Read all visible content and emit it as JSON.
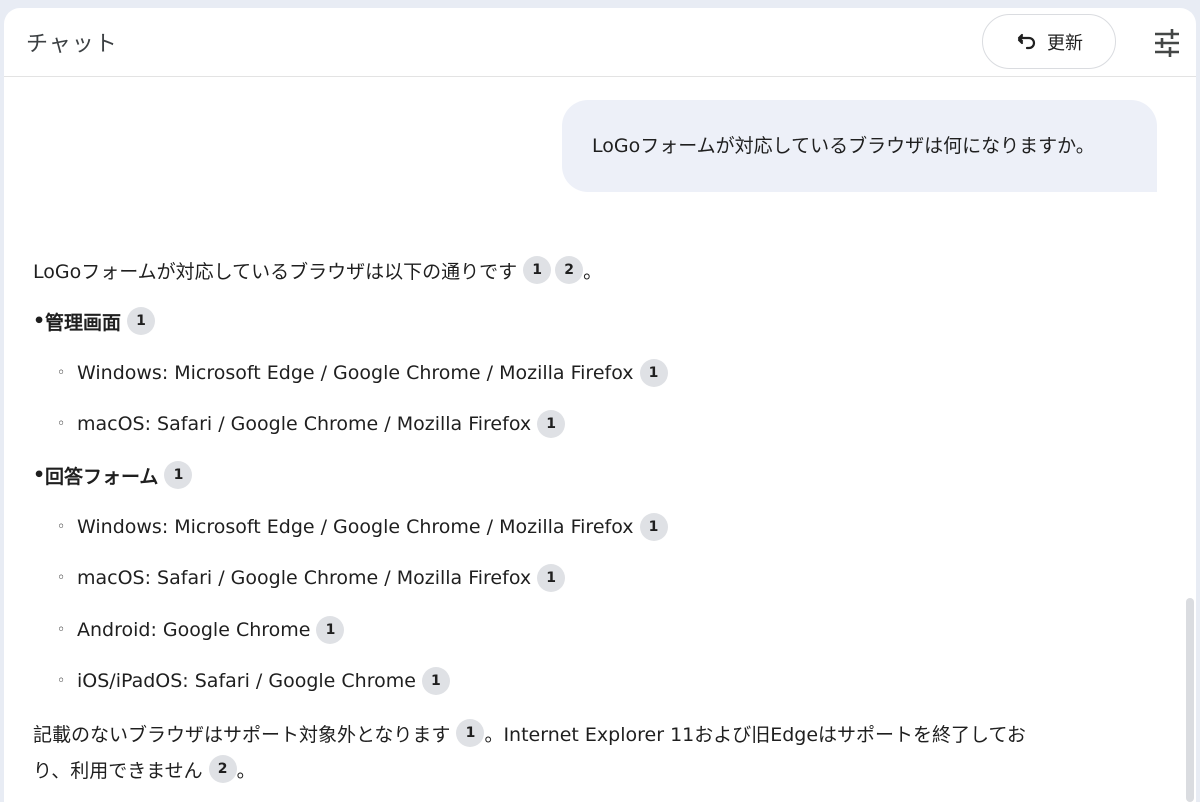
{
  "header": {
    "title": "チャット",
    "refresh_label": "更新",
    "refresh_icon": "refresh-icon",
    "tune_icon": "tune-icon"
  },
  "user_message": "LoGoフォームが対応しているブラウザは何になりますか。",
  "answer": {
    "intro": "LoGoフォームが対応しているブラウザは以下の通りです",
    "intro_cites": [
      "1",
      "2"
    ],
    "intro_end": "。",
    "sections": [
      {
        "title": "管理画面",
        "cite": "1",
        "items": [
          {
            "text": "Windows: Microsoft Edge / Google Chrome / Mozilla Firefox",
            "cite": "1"
          },
          {
            "text": "macOS: Safari / Google Chrome / Mozilla Firefox",
            "cite": "1"
          }
        ]
      },
      {
        "title": "回答フォーム",
        "cite": "1",
        "items": [
          {
            "text": "Windows: Microsoft Edge / Google Chrome / Mozilla Firefox",
            "cite": "1"
          },
          {
            "text": "macOS: Safari / Google Chrome / Mozilla Firefox",
            "cite": "1"
          },
          {
            "text": "Android: Google Chrome",
            "cite": "1"
          },
          {
            "text": "iOS/iPadOS: Safari / Google Chrome",
            "cite": "1"
          }
        ]
      }
    ],
    "footer_part1": "記載のないブラウザはサポート対象外となります",
    "footer_cite1": "1",
    "footer_part2": "。Internet Explorer 11および旧Edgeはサポートを終了してお",
    "footer_part3": "り、利用できません",
    "footer_cite2": "2",
    "footer_end": "。"
  },
  "bullet_char": "•",
  "sub_bullet_char": "◦"
}
